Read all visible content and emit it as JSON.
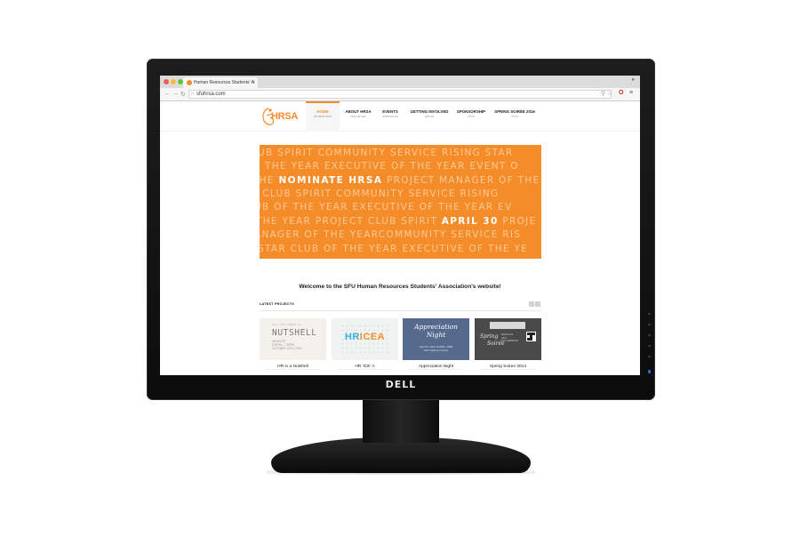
{
  "browser": {
    "tab_title": "Human Resources Students' A",
    "tab_close": "×",
    "url": "sfuhrsa.com",
    "window_control": "‹ ›"
  },
  "site": {
    "logo_text": "HRSA",
    "nav": [
      {
        "label": "HOME",
        "sub": "all starts here"
      },
      {
        "label": "ABOUT HRSA",
        "sub": "who we are"
      },
      {
        "label": "EVENTS",
        "sub": "what we do"
      },
      {
        "label": "GETTING INVOLVED",
        "sub": "join us"
      },
      {
        "label": "SPONSORSHIP",
        "sub": "2015"
      },
      {
        "label": "SPRING SOIRÉE 2016",
        "sub": "2016"
      }
    ],
    "banner_lines": [
      "UB SPIRIT COMMUNITY SERVICE RISING STAR",
      "F THE YEAR EXECUTIVE OF THE YEAR EVENT O",
      {
        "pre": "THE ",
        "hl": "NOMINATE HRSA",
        "post": " PROJECT MANAGER OF THE"
      },
      "R CLUB SPIRIT COMMUNITY SERVICE RISING",
      "UB OF THE YEAR EXECUTIVE OF THE YEAR EV",
      {
        "pre": "THE YEAR PROJECT CLUB SPIRIT ",
        "hl": "APRIL 30",
        "post": " PROJE"
      },
      "ANAGER OF THE YEARCOMMUNITY SERVICE RIS",
      "STAR CLUB OF THE YEAR EXECUTIVE OF THE YE"
    ],
    "welcome": "Welcome to the SFU Human Resources Students' Association's website!",
    "latest_projects_heading": "LATEST PROJECTS",
    "slider_prev": "‹",
    "slider_next": "›",
    "projects": [
      {
        "caption": "HR in a Nutshell",
        "image_text": {
          "pre": "ALL YOU NEED IS...",
          "title": "NUTSHELL",
          "meta": [
            "DEVELOP",
            "5:30PM - 7:30PM",
            "OCTOBER 14TH, 2015"
          ]
        }
      },
      {
        "caption": "HR 'ICE' A",
        "image_text": {
          "hr": "HR",
          "ice": "ICEA"
        }
      },
      {
        "caption": "Appreciation Night",
        "image_text": {
          "line1": "Appreciation",
          "line2": "Night",
          "meta": [
            "April 24, 2014 at 5PM - 8PM",
            "SFU Harbour Centre"
          ]
        }
      },
      {
        "caption": "Spring Soiree 2014",
        "image_text": {
          "line1": "Spring",
          "line2": "Soirée",
          "meta": [
            "MARCH 22",
            "2014",
            "SFU HARBOUR"
          ]
        }
      }
    ]
  },
  "monitor": {
    "brand": "DELL"
  },
  "colors": {
    "accent": "#f58c2a",
    "banner_text": "#fcc894",
    "bezel": "#111111"
  }
}
